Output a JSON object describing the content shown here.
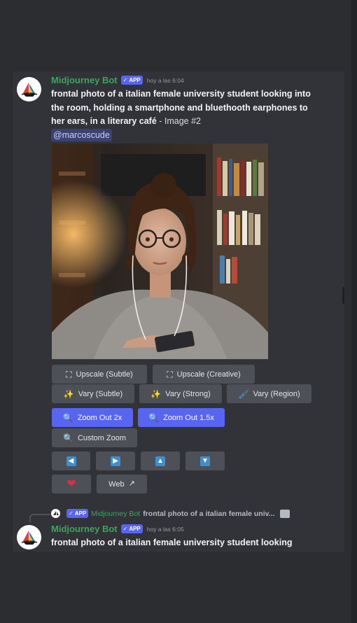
{
  "messages": [
    {
      "author": "Midjourney Bot",
      "badge": "APP",
      "timestamp": "hoy a las 6:04",
      "prompt": "frontal photo of a italian female university student looking into the room, holding a smartphone and bluethooth earphones to her ears, in a literary café",
      "suffix": " - Image #2",
      "mention": "@marcoscude"
    }
  ],
  "buttons": {
    "upscale_subtle": "Upscale (Subtle)",
    "upscale_creative": "Upscale (Creative)",
    "vary_subtle": "Vary (Subtle)",
    "vary_strong": "Vary (Strong)",
    "vary_region": "Vary (Region)",
    "zoom_out_2x": "Zoom Out 2x",
    "zoom_out_1_5x": "Zoom Out 1.5x",
    "custom_zoom": "Custom Zoom",
    "web": "Web"
  },
  "reply": {
    "badge": "APP",
    "author": "Midjourney Bot",
    "text": "frontal photo of a italian female univ..."
  },
  "second_message": {
    "author": "Midjourney Bot",
    "badge": "APP",
    "timestamp": "hoy a las 6:05",
    "prompt": "frontal photo of a italian female university student looking"
  },
  "colors": {
    "background": "#2b2d31",
    "chat": "#313338",
    "bot_name": "#3ba55d",
    "blurple": "#5865f2",
    "button_gray": "#4e5058"
  },
  "icons": [
    "upscale-icon",
    "magic-wand-icon",
    "brush-icon",
    "magnifier-icon",
    "arrow-left-icon",
    "arrow-right-icon",
    "arrow-up-icon",
    "arrow-down-icon",
    "heart-icon",
    "external-link-icon",
    "image-icon"
  ]
}
